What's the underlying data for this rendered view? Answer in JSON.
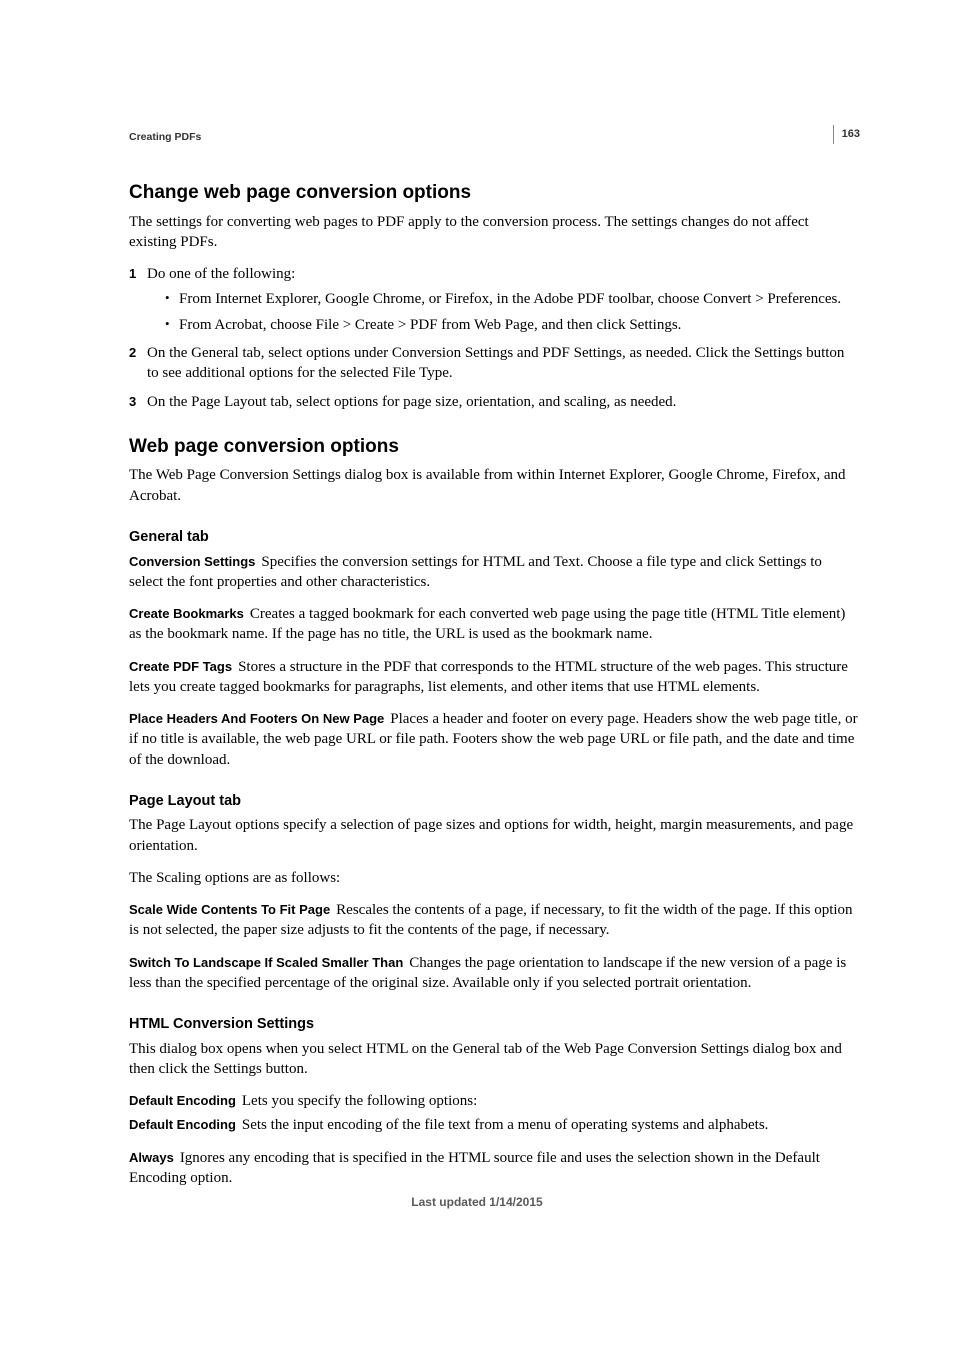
{
  "page_number": "163",
  "breadcrumb": "Creating PDFs",
  "section1": {
    "title": "Change web page conversion options",
    "intro": "The settings for converting web pages to PDF apply to the conversion process. The settings changes do not affect existing PDFs.",
    "steps": [
      {
        "text": "Do one of the following:",
        "sub": [
          "From Internet Explorer, Google Chrome, or Firefox, in the Adobe PDF toolbar, choose Convert > Preferences.",
          "From Acrobat, choose File > Create > PDF from Web Page, and then click Settings."
        ]
      },
      {
        "text": "On the General tab, select options under Conversion Settings and PDF Settings, as needed. Click the Settings button to see additional options for the selected File Type."
      },
      {
        "text": "On the Page Layout tab, select options for page size, orientation, and scaling, as needed."
      }
    ]
  },
  "section2": {
    "title": "Web page conversion options",
    "intro": "The Web Page Conversion Settings dialog box is available from within Internet Explorer, Google Chrome, Firefox, and Acrobat.",
    "general": {
      "heading": "General tab",
      "items": [
        {
          "term": "Conversion Settings",
          "desc": "Specifies the conversion settings for HTML and Text. Choose a file type and click Settings to select the font properties and other characteristics."
        },
        {
          "term": "Create Bookmarks",
          "desc": "Creates a tagged bookmark for each converted web page using the page title (HTML Title element) as the bookmark name. If the page has no title, the URL is used as the bookmark name."
        },
        {
          "term": "Create PDF Tags",
          "desc": "Stores a structure in the PDF that corresponds to the HTML structure of the web pages. This structure lets you create tagged bookmarks for paragraphs, list elements, and other items that use HTML elements."
        },
        {
          "term": "Place Headers And Footers On New Page",
          "desc": "Places a header and footer on every page. Headers show the web page title, or if no title is available, the web page URL or file path. Footers show the web page URL or file path, and the date and time of the download."
        }
      ]
    },
    "page_layout": {
      "heading": "Page Layout tab",
      "intro": "The Page Layout options specify a selection of page sizes and options for width, height, margin measurements, and page orientation.",
      "scaling_intro": "The Scaling options are as follows:",
      "items": [
        {
          "term": "Scale Wide Contents To Fit Page",
          "desc": "Rescales the contents of a page, if necessary, to fit the width of the page. If this option is not selected, the paper size adjusts to fit the contents of the page, if necessary."
        },
        {
          "term": "Switch To Landscape If Scaled Smaller Than",
          "desc": "Changes the page orientation to landscape if the new version of a page is less than the specified percentage of the original size. Available only if you selected portrait orientation."
        }
      ]
    },
    "html_settings": {
      "heading": "HTML Conversion Settings",
      "intro": "This dialog box opens when you select HTML on the General tab of the Web Page Conversion Settings dialog box and then click the Settings button.",
      "items": [
        {
          "term": "Default Encoding",
          "desc": "Lets you specify the following options:"
        },
        {
          "term": "Default Encoding",
          "desc": "Sets the input encoding of the file text from a menu of operating systems and alphabets."
        },
        {
          "term": "Always",
          "desc": "Ignores any encoding that is specified in the HTML source file and uses the selection shown in the Default Encoding option."
        }
      ]
    }
  },
  "footer": "Last updated 1/14/2015"
}
